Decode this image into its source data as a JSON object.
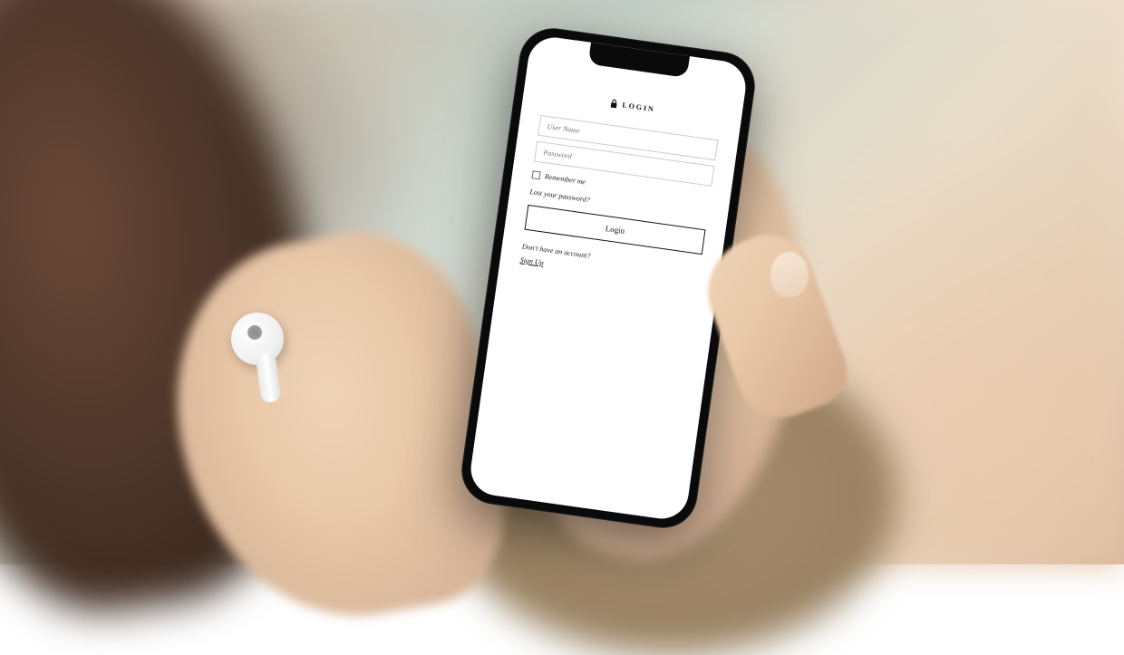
{
  "login": {
    "title": "LOGIN",
    "username_placeholder": "User Name",
    "password_placeholder": "Password",
    "remember_label": "Remember me",
    "lost_password": "Lost your password?",
    "button_label": "Login",
    "signup_prompt": "Don't have an account?",
    "signup_link": "Sign Up"
  }
}
